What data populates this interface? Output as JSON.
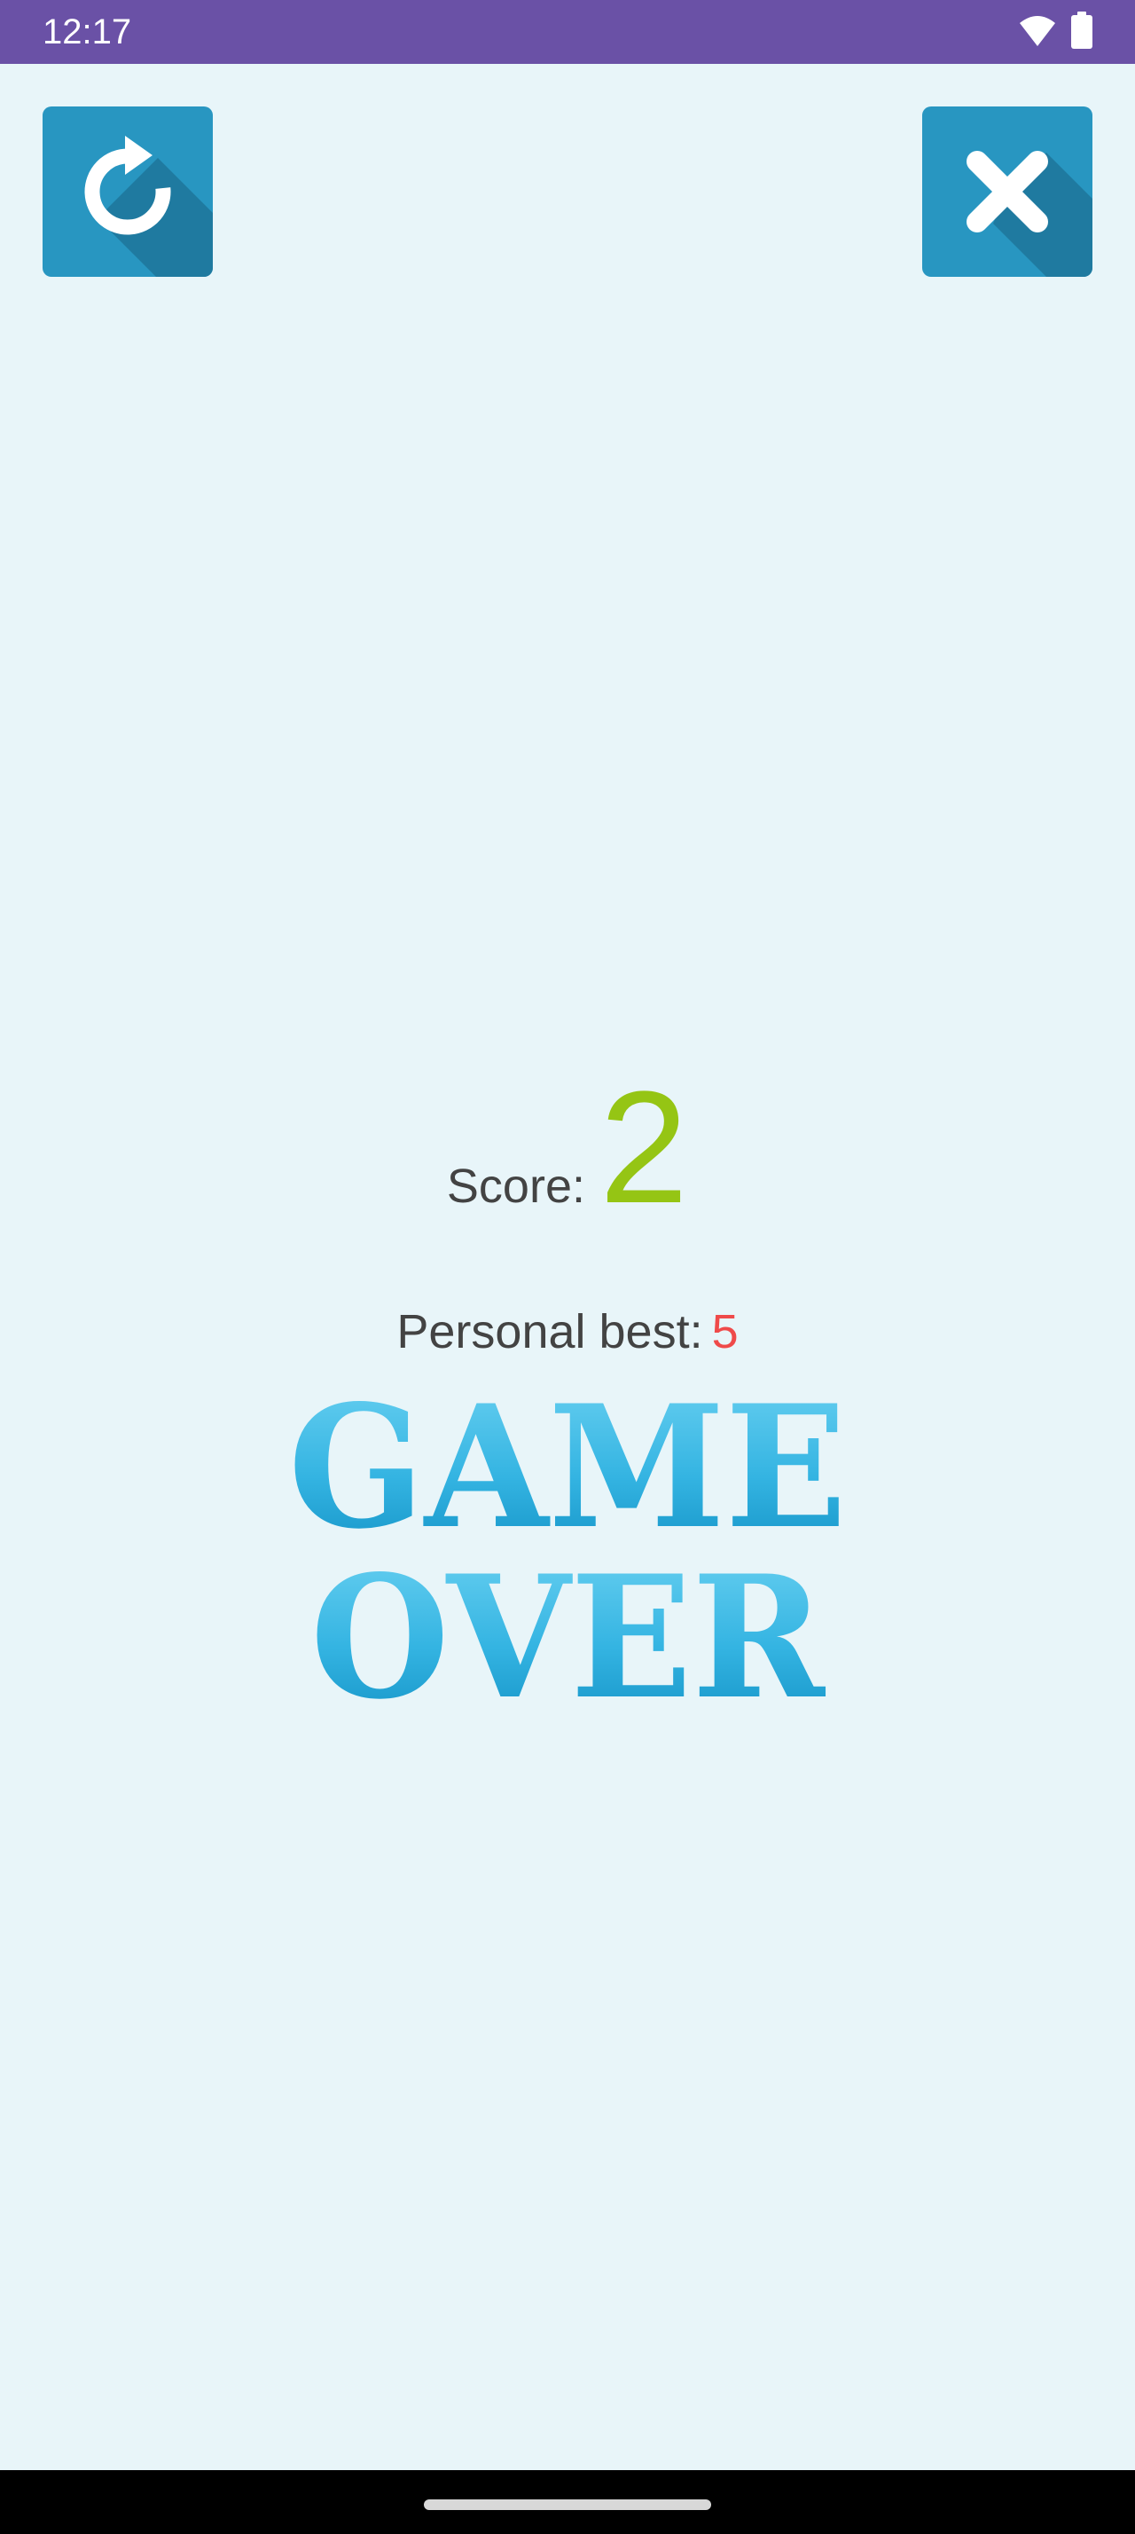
{
  "status_bar": {
    "time": "12:17",
    "wifi_icon": "wifi-icon",
    "battery_icon": "battery-icon"
  },
  "toolbar": {
    "restart_icon": "restart-icon",
    "close_icon": "close-icon",
    "button_color": "#2896c1"
  },
  "result": {
    "score_label": "Score:",
    "score_value": "2",
    "best_label": "Personal best:",
    "best_value": "5",
    "title_line1": "GAME",
    "title_line2": "OVER"
  },
  "colors": {
    "status_bar": "#6a51a6",
    "background": "#e8f5f9",
    "score_value": "#95c514",
    "best_value": "#ef4a4a",
    "title_light": "#5cc8ec",
    "title_dark": "#1690c2"
  }
}
